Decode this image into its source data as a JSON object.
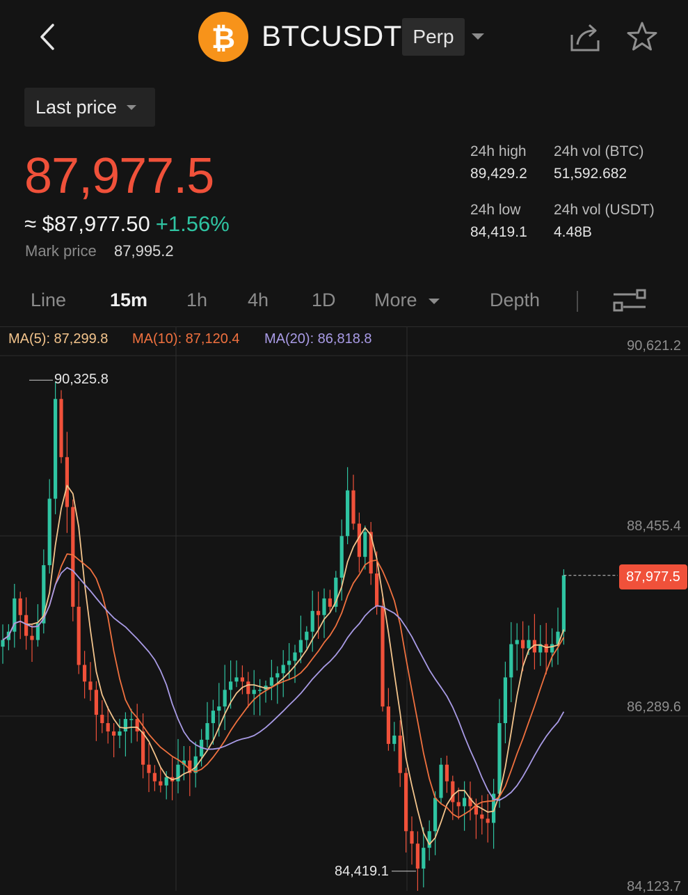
{
  "header": {
    "symbol": "BTCUSDT",
    "contract_type": "Perp",
    "icons": [
      "back-arrow-icon",
      "bitcoin-logo-icon",
      "chevron-down-icon",
      "share-icon",
      "star-icon"
    ]
  },
  "price_type": {
    "label": "Last price"
  },
  "ticker": {
    "last_price": "87,977.5",
    "usd_equiv": "≈ $87,977.50",
    "change_pct": "+1.56%",
    "mark_price_label": "Mark price",
    "mark_price": "87,995.2"
  },
  "stats": {
    "high_label": "24h high",
    "high_value": "89,429.2",
    "low_label": "24h low",
    "low_value": "84,419.1",
    "vol_btc_label": "24h vol (BTC)",
    "vol_btc_value": "51,592.682",
    "vol_usdt_label": "24h vol (USDT)",
    "vol_usdt_value": "4.48B"
  },
  "tabs": [
    {
      "label": "Line",
      "active": false
    },
    {
      "label": "15m",
      "active": true
    },
    {
      "label": "1h",
      "active": false
    },
    {
      "label": "4h",
      "active": false
    },
    {
      "label": "1D",
      "active": false
    },
    {
      "label": "More",
      "active": false
    },
    {
      "label": "Depth",
      "active": false
    }
  ],
  "colors": {
    "up": "#2fc4a2",
    "down": "#f0513a",
    "ma5": "#f3c48c",
    "ma10": "#f0713f",
    "ma20": "#a99be6",
    "bg": "#141414"
  },
  "ma_legend": {
    "ma5": "MA(5): 87,299.8",
    "ma10": "MA(10): 87,120.4",
    "ma20": "MA(20): 86,818.8"
  },
  "axis": {
    "ticks": [
      "90,621.2",
      "88,455.4",
      "86,289.6",
      "84,123.7"
    ],
    "current_price_tag": "87,977.5",
    "high_marker": "90,325.8",
    "low_marker": "84,419.1"
  },
  "chart_data": {
    "type": "candlestick",
    "interval": "15m",
    "ylim": [
      84123.7,
      90621.2
    ],
    "close_series": [
      87200,
      87300,
      87700,
      87500,
      87250,
      87200,
      87400,
      88100,
      88900,
      90100,
      89400,
      88800,
      87600,
      86900,
      86700,
      86600,
      86300,
      86200,
      86100,
      86050,
      86100,
      86250,
      86250,
      86100,
      85700,
      85600,
      85500,
      85450,
      85550,
      85500,
      85700,
      85750,
      85600,
      85800,
      86000,
      86200,
      86350,
      86400,
      86600,
      86700,
      86750,
      86700,
      86550,
      86600,
      86600,
      86650,
      86750,
      86800,
      86900,
      86950,
      87050,
      87200,
      87300,
      87550,
      87500,
      87700,
      87600,
      87950,
      88450,
      89000,
      88600,
      88200,
      88500,
      88000,
      87600,
      86400,
      85950,
      86050,
      85600,
      84900,
      84750,
      84450,
      84700,
      84900,
      85300,
      85700,
      85500,
      85250,
      85200,
      85300,
      85200,
      85100,
      85050,
      85000,
      85350,
      86200,
      86750,
      87150,
      87200,
      87100,
      87200,
      87050,
      87150,
      87050,
      87150,
      87300,
      87977.5
    ],
    "ma5_last": 87299.8,
    "ma10_last": 87120.4,
    "ma20_last": 86818.8,
    "period_high": 90325.8,
    "period_low": 84419.1
  }
}
